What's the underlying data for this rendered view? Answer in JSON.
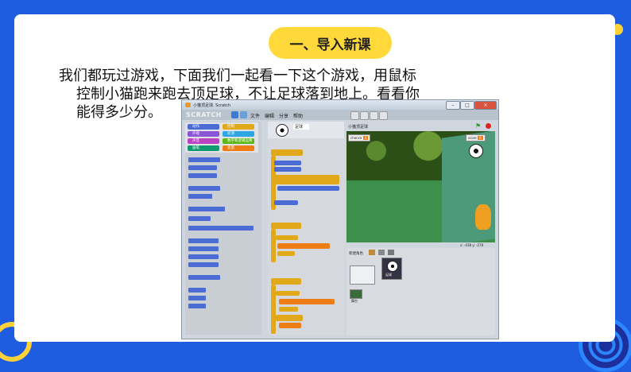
{
  "slide": {
    "title": "一、导入新课",
    "intro_lines": [
      "我们都玩过游戏，下面我们一起看一下这个游戏，用鼠标",
      "控制小猫跑来跑去顶足球，不让足球落到地上。看看你",
      "能得多少分。"
    ]
  },
  "colors": {
    "background": "#1f5de0",
    "title_pill": "#ffd93a",
    "accent_ring": "#ffd23a"
  },
  "scratch_window": {
    "window_title": "小猫顶足球. Scratch",
    "logo": "SCRATCH",
    "menu": [
      "文件",
      "编辑",
      "分享",
      "帮助"
    ],
    "categories": [
      "动作",
      "外观",
      "声音",
      "画笔",
      "控制",
      "侦测",
      "数字和逻辑运算",
      "变量"
    ],
    "sprite_name": "足球",
    "tabs": [
      "脚本",
      "造型",
      "声音"
    ],
    "stage_title": "小猫顶足球",
    "variables": {
      "chance_label": "chance",
      "chance_value": "3",
      "score_label": "score",
      "score_value": "0"
    },
    "new_sprite_label": "新建角色",
    "sprite_thumb_label": "足球",
    "stage_thumb_label": "舞台",
    "coords": "x: -438  y: -278"
  }
}
